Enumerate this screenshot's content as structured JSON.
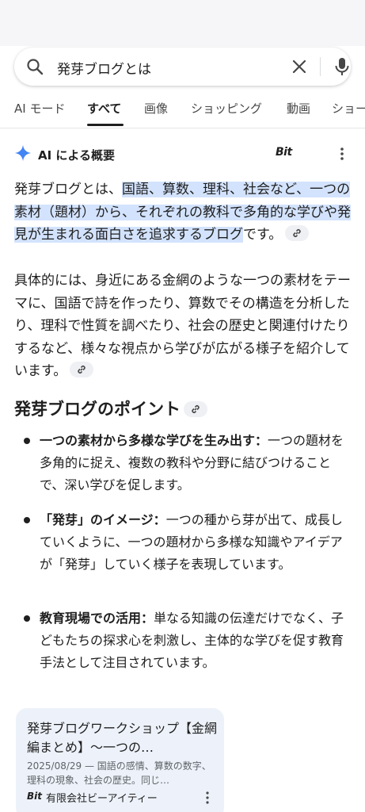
{
  "search": {
    "query": "発芽ブログとは"
  },
  "tabs": [
    {
      "label": "AI モード"
    },
    {
      "label": "すべて"
    },
    {
      "label": "画像"
    },
    {
      "label": "ショッピング"
    },
    {
      "label": "動画"
    },
    {
      "label": "ショー"
    }
  ],
  "ai_overview": {
    "title": "AI による概要",
    "source_logo": "Bit",
    "para1_plain": "発芽ブログとは、",
    "para1_highlight": "国語、算数、理科、社会など、一つの素材（題材）から、それぞれの教科で多角的な学びや発見が生まれる面白さを追求するブログ",
    "para1_tail": "です。",
    "para2": "具体的には、身近にある金網のような一つの素材をテーマに、国語で詩を作ったり、算数でその構造を分析したり、理科で性質を調べたり、社会の歴史と関連付けたりするなど、様々な視点から学びが広がる様子を紹介しています。",
    "heading": "発芽ブログのポイント",
    "points": [
      {
        "lead": "一つの素材から多様な学びを生み出す：",
        "text": "一つの題材を多角的に捉え、複数の教科や分野に結びつけることで、深い学びを促します。"
      },
      {
        "lead": "「発芽」のイメージ：",
        "text": "一つの種から芽が出て、成長していくように、一つの題材から多様な知識やアイデアが「発芽」していく様子を表現しています。"
      },
      {
        "lead": "教育現場での活用：",
        "text": "単なる知識の伝達だけでなく、子どもたちの探求心を刺激し、主体的な学びを促す教育手法として注目されています。"
      }
    ]
  },
  "card": {
    "title": "発芽ブログワークショップ【金網編まとめ】〜一つの…",
    "snippet": "2025/08/29 — 国語の感情、算数の数字、理科の現象、社会の歴史。同じ…",
    "source_logo": "Bit",
    "source_name": "有限会社ビーアイティー"
  },
  "colors": {
    "highlight": "#d3e3fd",
    "card_bg": "#edf2fa",
    "gemini_blue": "#4285f4"
  }
}
